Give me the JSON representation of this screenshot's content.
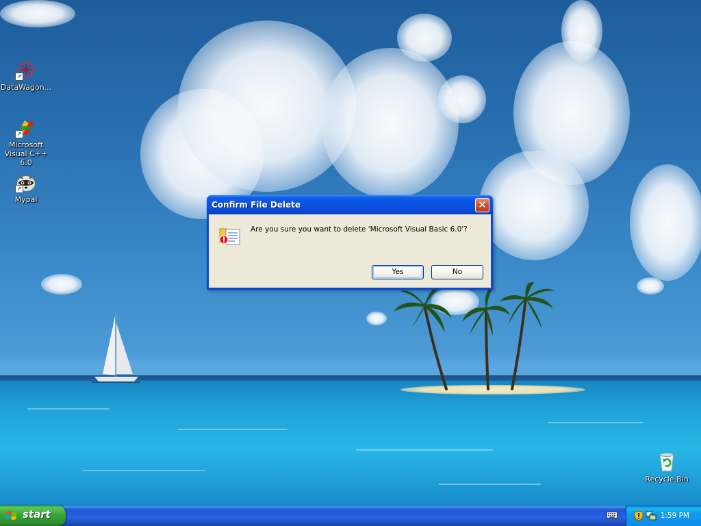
{
  "desktop": {
    "icons": [
      {
        "label": "DataWagon...",
        "icon": "datawagon-icon"
      },
      {
        "label": "Microsoft Visual C++ 6.0",
        "icon": "visual-cpp-icon"
      },
      {
        "label": "Mypal",
        "icon": "mypal-icon"
      },
      {
        "label": "Recycle Bin",
        "icon": "recycle-bin-icon"
      }
    ]
  },
  "dialog": {
    "title": "Confirm File Delete",
    "message": "Are you sure you want to delete 'Microsoft Visual Basic 6.0'?",
    "yes_label": "Yes",
    "no_label": "No",
    "close_glyph": "✕",
    "icon": "delete-file-warning-icon"
  },
  "taskbar": {
    "start_label": "start",
    "clock": "1:59 PM",
    "tray_icons": [
      "keyboard-icon",
      "security-shield-icon",
      "network-icon"
    ]
  },
  "colors": {
    "titlebar": "#0a52df",
    "dialog_face": "#ece9d8",
    "taskbar": "#2663e0",
    "start_button": "#3aa53a",
    "systray": "#139beb",
    "close_button": "#d7522f"
  }
}
